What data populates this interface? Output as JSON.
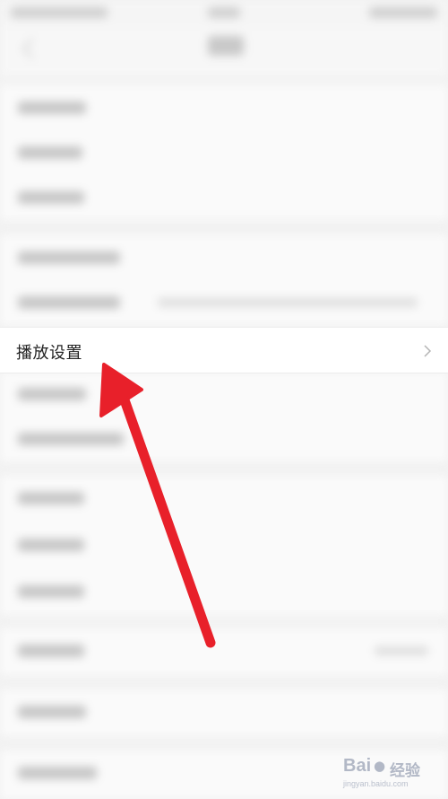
{
  "focused_row": {
    "label": "播放设置",
    "chevron_icon": "chevron-right-icon"
  },
  "overlay": {
    "arrow_color": "#e8202a",
    "arrow_icon": "red-pointer-arrow-icon"
  },
  "watermark": {
    "brand": "Bai",
    "paw_icon": "paw-icon",
    "suffix": "经验",
    "site": "jingyan.baidu.com"
  }
}
